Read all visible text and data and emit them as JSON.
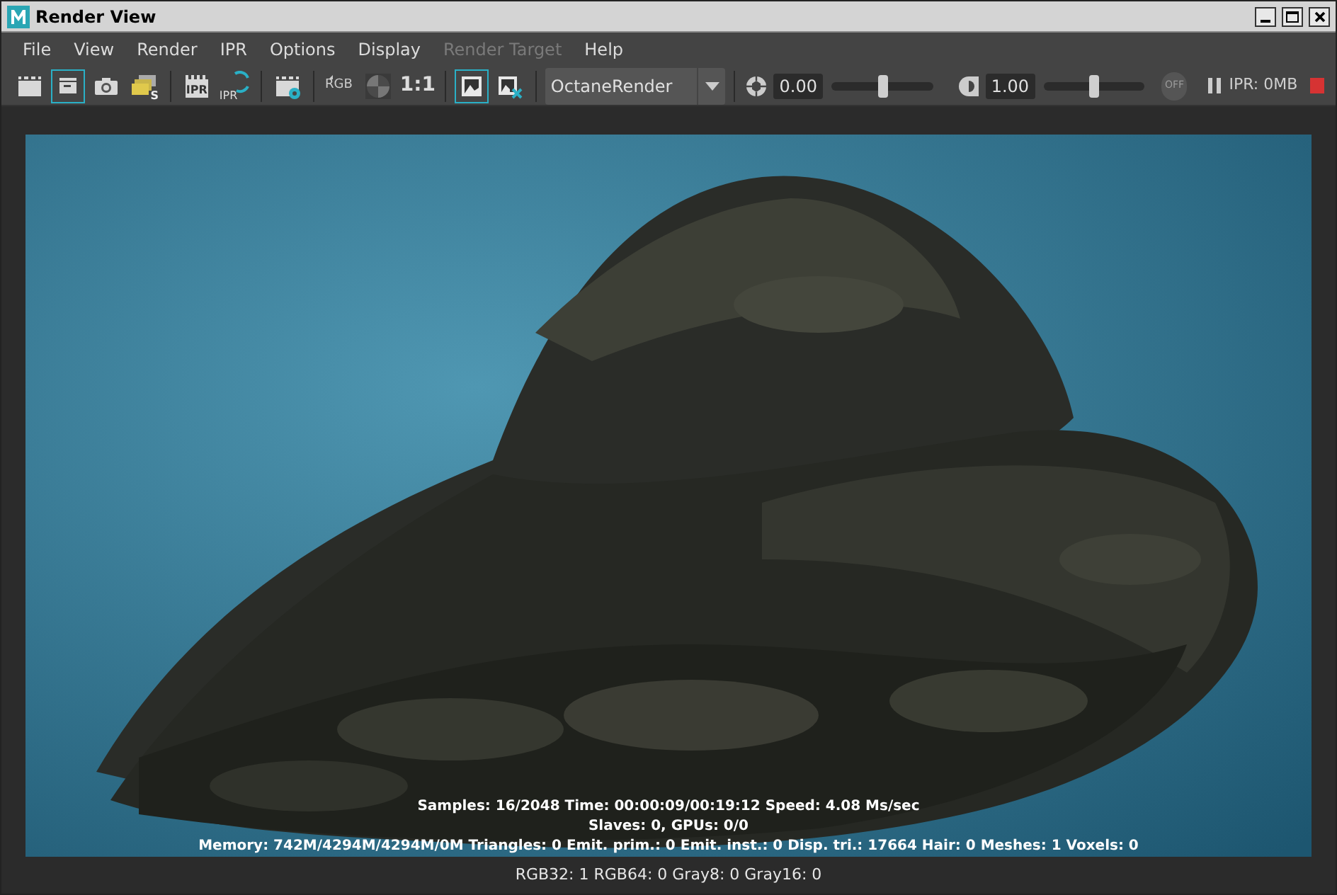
{
  "window": {
    "title": "Render View"
  },
  "menu": [
    {
      "label": "File",
      "disabled": false
    },
    {
      "label": "View",
      "disabled": false
    },
    {
      "label": "Render",
      "disabled": false
    },
    {
      "label": "IPR",
      "disabled": false
    },
    {
      "label": "Options",
      "disabled": false
    },
    {
      "label": "Display",
      "disabled": false
    },
    {
      "label": "Render Target",
      "disabled": true
    },
    {
      "label": "Help",
      "disabled": false
    }
  ],
  "toolbar": {
    "groups": [
      [
        {
          "selected": false
        },
        {
          "selected": true
        },
        {
          "selected": false
        },
        {
          "label": "S",
          "selected": false
        }
      ],
      [
        {
          "label": "IPR",
          "selected": false
        },
        {
          "label": "IPR",
          "selected": false
        }
      ],
      [
        {
          "selected": false
        }
      ],
      [
        {
          "label": "RGB",
          "selected": false
        },
        {
          "selected": false
        },
        {
          "label": "1:1",
          "selected": false
        }
      ],
      [
        {
          "selected": true
        },
        {
          "selected": false
        }
      ]
    ],
    "renderer": "OctaneRender",
    "exposure": {
      "value": "0.00",
      "level": 0.5
    },
    "gamma": {
      "value": "1.00",
      "level": 0.5
    },
    "off_toggle": {
      "label": "OFF",
      "disabled": true
    },
    "ipr_status": "IPR: 0MB"
  },
  "render_stats": [
    "Samples: 16/2048 Time: 00:00:09/00:19:12 Speed: 4.08 Ms/sec",
    "Slaves: 0, GPUs: 0/0",
    "Memory: 742M/4294M/4294M/0M Triangles: 0 Emit. prim.: 0 Emit. inst.: 0 Disp. tri.: 17664 Hair: 0 Meshes: 1 Voxels: 0"
  ],
  "status_bar": "RGB32: 1 RGB64: 0 Gray8: 0 Gray16: 0"
}
